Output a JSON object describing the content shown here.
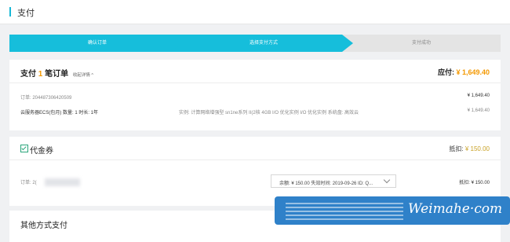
{
  "page": {
    "title": "支付"
  },
  "steps": [
    {
      "label": "确认订单"
    },
    {
      "label": "选择支付方式"
    },
    {
      "label": "支付成功"
    }
  ],
  "order": {
    "heading_prefix": "支付",
    "count": "1",
    "heading_suffix": "笔订单",
    "detail_link": "收起详情 ^",
    "due_label": "应付:",
    "due_value": "¥ 1,649.40",
    "order_no_label": "订单:",
    "order_no": "204487306420509",
    "order_amount": "¥ 1,649.40",
    "product": "云服务器ECS(包月) 数量: 1 时长: 1年",
    "spec": "实例: 计算网络增强型 sn1ne系列 II(2核 4GB I/O 优化实例 I/O 优化实例 系统盘: 高效云",
    "line_amount": "¥ 1,649.40"
  },
  "voucher": {
    "title": "代金券",
    "checked": true,
    "deduct_label": "抵扣:",
    "deduct_value": "¥ 150.00",
    "order_label": "订单: 2(",
    "selected_option": "余额: ¥ 150.00 失效时间: 2019-09-26 ID: Q...",
    "row_deduct": "抵扣: ¥ 150.00"
  },
  "other_payment": {
    "title": "其他方式支付"
  },
  "watermark": {
    "text": "Weimahe·com"
  },
  "colors": {
    "accent": "#16bedb",
    "price": "#f39800",
    "check": "#2aa57a",
    "watermark_bg": "#2f81c9"
  }
}
